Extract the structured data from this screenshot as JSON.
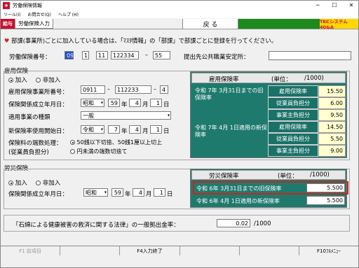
{
  "window": {
    "title": "労働保険情報",
    "app_icon": "app-icon"
  },
  "menu": [
    "ツール(I)",
    "お問合せ(Q)",
    "ヘルプ (H)"
  ],
  "toolbar": {
    "logo": "給与",
    "tab": "労働保険入力",
    "back": "戻 る",
    "tkc": "TKCシステム40&A"
  },
  "notice": "部課(事業所)ごとに加入している場合は、「ﾏｽﾀ情報」の「部課」で部課ごとに登録を行ってください。",
  "labour_number": {
    "label": "労働保険番号：",
    "f1": "09",
    "f2": "1",
    "f3": "11",
    "f4": "122334",
    "dash": "–",
    "f5": "55"
  },
  "office": {
    "label": "提出先公共職業安定所：",
    "value": ""
  },
  "employment": {
    "title": "雇用保険",
    "join": "加入",
    "nojoin": "非加入",
    "office_no_label": "雇用保険事業所番号：",
    "office_no1": "0911",
    "office_no2": "112233",
    "office_no3": "4",
    "est_label": "保険関係成立年月日：",
    "est_era": "昭和",
    "est_year": "59",
    "year": "年",
    "est_month": "4",
    "month": "月",
    "est_day": "1",
    "day": "日",
    "type_label": "適用事業の種類",
    "type_value": "一般",
    "newrate_label": "新保険率使用開始日：",
    "newrate_era": "令和",
    "newrate_year": "7",
    "newrate_month": "4",
    "newrate_day": "1",
    "rounding_label": "保険料の端数処理：",
    "rounding_label2": "(従業員負担分)",
    "rounding_opt1": "50銭以下切捨、50銭1厘以上切上",
    "rounding_opt2": "円未満の端数切捨て"
  },
  "emp_rates": {
    "header": "雇用保険率",
    "unit": "(単位：",
    "unit2": "/1000)",
    "old_label": "令和 7年 3月31日までの旧保険率",
    "new_label": "令和 7年 4月 1日適用の新保険率",
    "row_labels": [
      "雇用保険率",
      "従業員負担分",
      "事業主負担分"
    ],
    "old_values": [
      "15.50",
      "6.00",
      "9.50"
    ],
    "new_values": [
      "14.50",
      "5.50",
      "9.00"
    ]
  },
  "workers": {
    "title": "労災保険",
    "join": "加入",
    "nojoin": "非加入",
    "est_label": "保険関係成立年月日：",
    "est_era": "昭和",
    "est_year": "59",
    "year": "年",
    "est_month": "4",
    "month": "月",
    "est_day": "1",
    "day": "日"
  },
  "wc_rates": {
    "header": "労災保険率",
    "unit": "(単位：",
    "unit2": "/1000)",
    "old_label": "令和 6年 3月31日までの旧保険率",
    "old_value": "5.500",
    "new_label": "令和 6年 4月 1日適用の新保険率",
    "new_value": "5.500"
  },
  "asbestos": {
    "label": "「石綿による健康被害の救済に関する法律」の一般拠出金率：",
    "value": "0.02",
    "unit": "/1000"
  },
  "status": [
    "F1 前項目",
    "",
    "F4入力終了",
    "",
    "",
    "F10ﾌﾙﾒﾆｭｰ"
  ],
  "colors": {
    "red": "#c8102e",
    "green": "#1c8a1c",
    "teal": "#1f7a6e",
    "yellow": "#ffd800",
    "highlight": "#d42020"
  }
}
